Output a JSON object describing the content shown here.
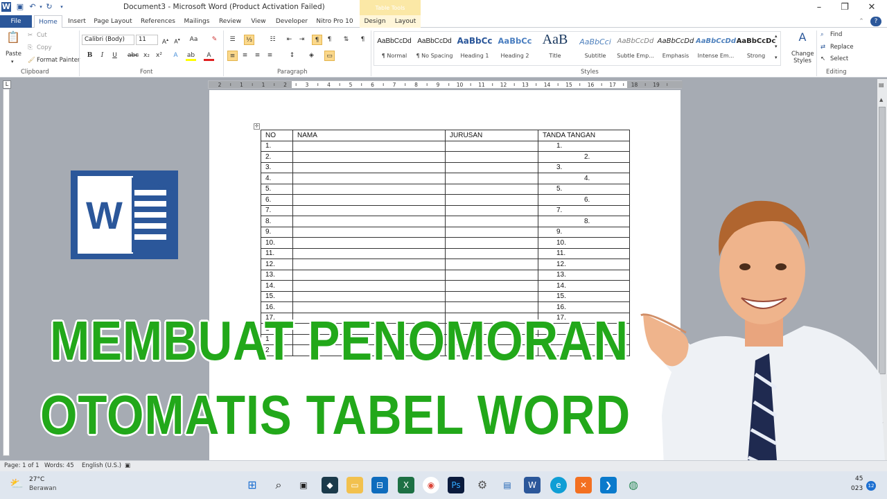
{
  "window": {
    "title": "Document3  -  Microsoft Word (Product Activation Failed)",
    "contextual_tab_group": "Table Tools",
    "controls": [
      "–",
      "❐",
      "✕"
    ]
  },
  "tabs": [
    "File",
    "Home",
    "Insert",
    "Page Layout",
    "References",
    "Mailings",
    "Review",
    "View",
    "Developer",
    "Nitro Pro 10",
    "Design",
    "Layout"
  ],
  "ribbon": {
    "clipboard": {
      "paste": "Paste",
      "cut": "Cut",
      "copy": "Copy",
      "format_painter": "Format Painter",
      "label": "Clipboard"
    },
    "font": {
      "name": "Calibri (Body)",
      "size": "11",
      "label": "Font"
    },
    "paragraph": {
      "label": "Paragraph"
    },
    "styles": {
      "label": "Styles",
      "items": [
        {
          "preview": "AaBbCcDd",
          "name": "¶ Normal"
        },
        {
          "preview": "AaBbCcDd",
          "name": "¶ No Spacing"
        },
        {
          "preview": "AaBbCc",
          "name": "Heading 1"
        },
        {
          "preview": "AaBbCc",
          "name": "Heading 2"
        },
        {
          "preview": "AaB",
          "name": "Title"
        },
        {
          "preview": "AaBbCci",
          "name": "Subtitle"
        },
        {
          "preview": "AaBbCcDd",
          "name": "Subtle Emp..."
        },
        {
          "preview": "AaBbCcDd",
          "name": "Emphasis"
        },
        {
          "preview": "AaBbCcDd",
          "name": "Intense Em..."
        },
        {
          "preview": "AaBbCcDc",
          "name": "Strong"
        }
      ],
      "change_styles": "Change Styles"
    },
    "editing": {
      "find": "Find",
      "replace": "Replace",
      "select": "Select",
      "label": "Editing"
    }
  },
  "ruler": {
    "numbers": [
      "2",
      "1",
      "1",
      "2",
      "3",
      "4",
      "5",
      "6",
      "7",
      "8",
      "9",
      "10",
      "11",
      "12",
      "13",
      "14",
      "15",
      "16",
      "17",
      "18",
      "19"
    ]
  },
  "table": {
    "headers": [
      "NO",
      "NAMA",
      "JURUSAN",
      "TANDA TANGAN"
    ],
    "rows": [
      {
        "no": "1.",
        "ttd": "1.",
        "indent": false
      },
      {
        "no": "2.",
        "ttd": "2.",
        "indent": true
      },
      {
        "no": "3.",
        "ttd": "3.",
        "indent": false
      },
      {
        "no": "4.",
        "ttd": "4.",
        "indent": true
      },
      {
        "no": "5.",
        "ttd": "5.",
        "indent": false
      },
      {
        "no": "6.",
        "ttd": "6.",
        "indent": true
      },
      {
        "no": "7.",
        "ttd": "7.",
        "indent": false
      },
      {
        "no": "8.",
        "ttd": "8.",
        "indent": true
      },
      {
        "no": "9.",
        "ttd": "9.",
        "indent": false
      },
      {
        "no": "10.",
        "ttd": "10.",
        "indent": false
      },
      {
        "no": "11.",
        "ttd": "11.",
        "indent": false
      },
      {
        "no": "12.",
        "ttd": "12.",
        "indent": false
      },
      {
        "no": "13.",
        "ttd": "13.",
        "indent": false
      },
      {
        "no": "14.",
        "ttd": "14.",
        "indent": false
      },
      {
        "no": "15.",
        "ttd": "15.",
        "indent": false
      },
      {
        "no": "16.",
        "ttd": "16.",
        "indent": false
      },
      {
        "no": "17.",
        "ttd": "17.",
        "indent": false
      },
      {
        "no": "1",
        "ttd": "",
        "indent": false
      },
      {
        "no": "1",
        "ttd": "",
        "indent": false
      },
      {
        "no": "2",
        "ttd": "",
        "indent": false
      }
    ]
  },
  "headline": {
    "line1": "MEMBUAT PENOMORAN",
    "line2": "OTOMATIS TABEL WORD"
  },
  "statusbar": {
    "page": "Page: 1 of 1",
    "words": "Words: 45",
    "language": "English (U.S.)"
  },
  "taskbar": {
    "temperature": "27°C",
    "weather": "Berawan",
    "time_partial": "45",
    "date_partial": "023",
    "notifications": "12"
  },
  "colors": {
    "word_blue": "#2b579a",
    "headline_green": "#22a81a",
    "accent_yellow": "#fbd88b"
  }
}
